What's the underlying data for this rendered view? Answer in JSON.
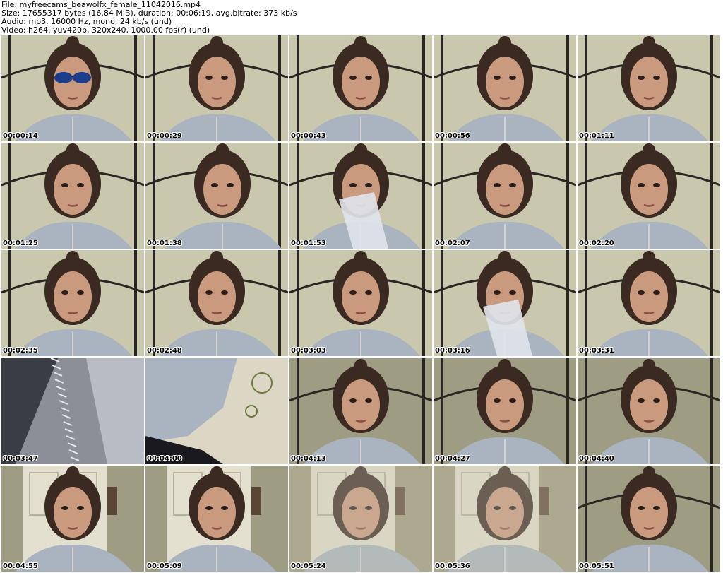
{
  "header": {
    "file_line": "File: myfreecams_beawolfx_female_11042016.mp4",
    "size_line": "Size: 17655317 bytes (16.84 MiB), duration: 00:06:19, avg.bitrate: 373 kb/s",
    "audio_line": "Audio: mp3, 16000 Hz, mono, 24 kb/s (und)",
    "video_line": "Video: h264, yuv420p, 320x240, 1000.00 fps(r) (und)"
  },
  "colors": {
    "wall_bright": "#c9c8ae",
    "wall_dim": "#9e9c82",
    "hoodie": "#a9b4c0",
    "hair": "#3a2a22",
    "skin": "#c99a7e",
    "headboard": "#2a2622",
    "dark_frame": "#4a4a50",
    "pillow": "#dcd6c4",
    "door": "#e4e0d0",
    "timestamp_text": "#000000"
  },
  "thumbnails": [
    {
      "timestamp": "00:00:14",
      "scene": "face-sunglasses"
    },
    {
      "timestamp": "00:00:29",
      "scene": "face"
    },
    {
      "timestamp": "00:00:43",
      "scene": "face"
    },
    {
      "timestamp": "00:00:56",
      "scene": "face"
    },
    {
      "timestamp": "00:01:11",
      "scene": "face"
    },
    {
      "timestamp": "00:01:25",
      "scene": "face"
    },
    {
      "timestamp": "00:01:38",
      "scene": "face-turned"
    },
    {
      "timestamp": "00:01:53",
      "scene": "face-cloth"
    },
    {
      "timestamp": "00:02:07",
      "scene": "face"
    },
    {
      "timestamp": "00:02:20",
      "scene": "face"
    },
    {
      "timestamp": "00:02:35",
      "scene": "face"
    },
    {
      "timestamp": "00:02:48",
      "scene": "face"
    },
    {
      "timestamp": "00:03:03",
      "scene": "face"
    },
    {
      "timestamp": "00:03:16",
      "scene": "face-cloth"
    },
    {
      "timestamp": "00:03:31",
      "scene": "face"
    },
    {
      "timestamp": "00:03:47",
      "scene": "zipper-closeup"
    },
    {
      "timestamp": "00:04:00",
      "scene": "hoodie-pillow"
    },
    {
      "timestamp": "00:04:13",
      "scene": "face"
    },
    {
      "timestamp": "00:04:27",
      "scene": "face"
    },
    {
      "timestamp": "00:04:40",
      "scene": "face"
    },
    {
      "timestamp": "00:04:55",
      "scene": "face-door"
    },
    {
      "timestamp": "00:05:09",
      "scene": "face-door"
    },
    {
      "timestamp": "00:05:24",
      "scene": "face-door-blur"
    },
    {
      "timestamp": "00:05:36",
      "scene": "face-door-blur"
    },
    {
      "timestamp": "00:05:51",
      "scene": "face"
    }
  ]
}
